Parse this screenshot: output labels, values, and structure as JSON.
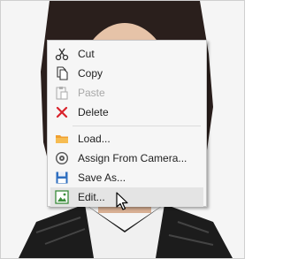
{
  "menu": {
    "items": [
      {
        "label": "Cut",
        "icon": "scissors-icon",
        "enabled": true
      },
      {
        "label": "Copy",
        "icon": "copy-icon",
        "enabled": true
      },
      {
        "label": "Paste",
        "icon": "paste-icon",
        "enabled": false
      },
      {
        "label": "Delete",
        "icon": "delete-x-icon",
        "enabled": true
      },
      {
        "label": "Load...",
        "icon": "folder-icon",
        "enabled": true
      },
      {
        "label": "Assign From Camera...",
        "icon": "camera-icon",
        "enabled": true
      },
      {
        "label": "Save As...",
        "icon": "save-disk-icon",
        "enabled": true
      },
      {
        "label": "Edit...",
        "icon": "edit-image-icon",
        "enabled": true,
        "hovered": true
      }
    ]
  },
  "colors": {
    "delete_red": "#d9232c",
    "folder_orange": "#f0a030",
    "save_blue": "#2f6fc0",
    "edit_green": "#3a8c3a"
  }
}
